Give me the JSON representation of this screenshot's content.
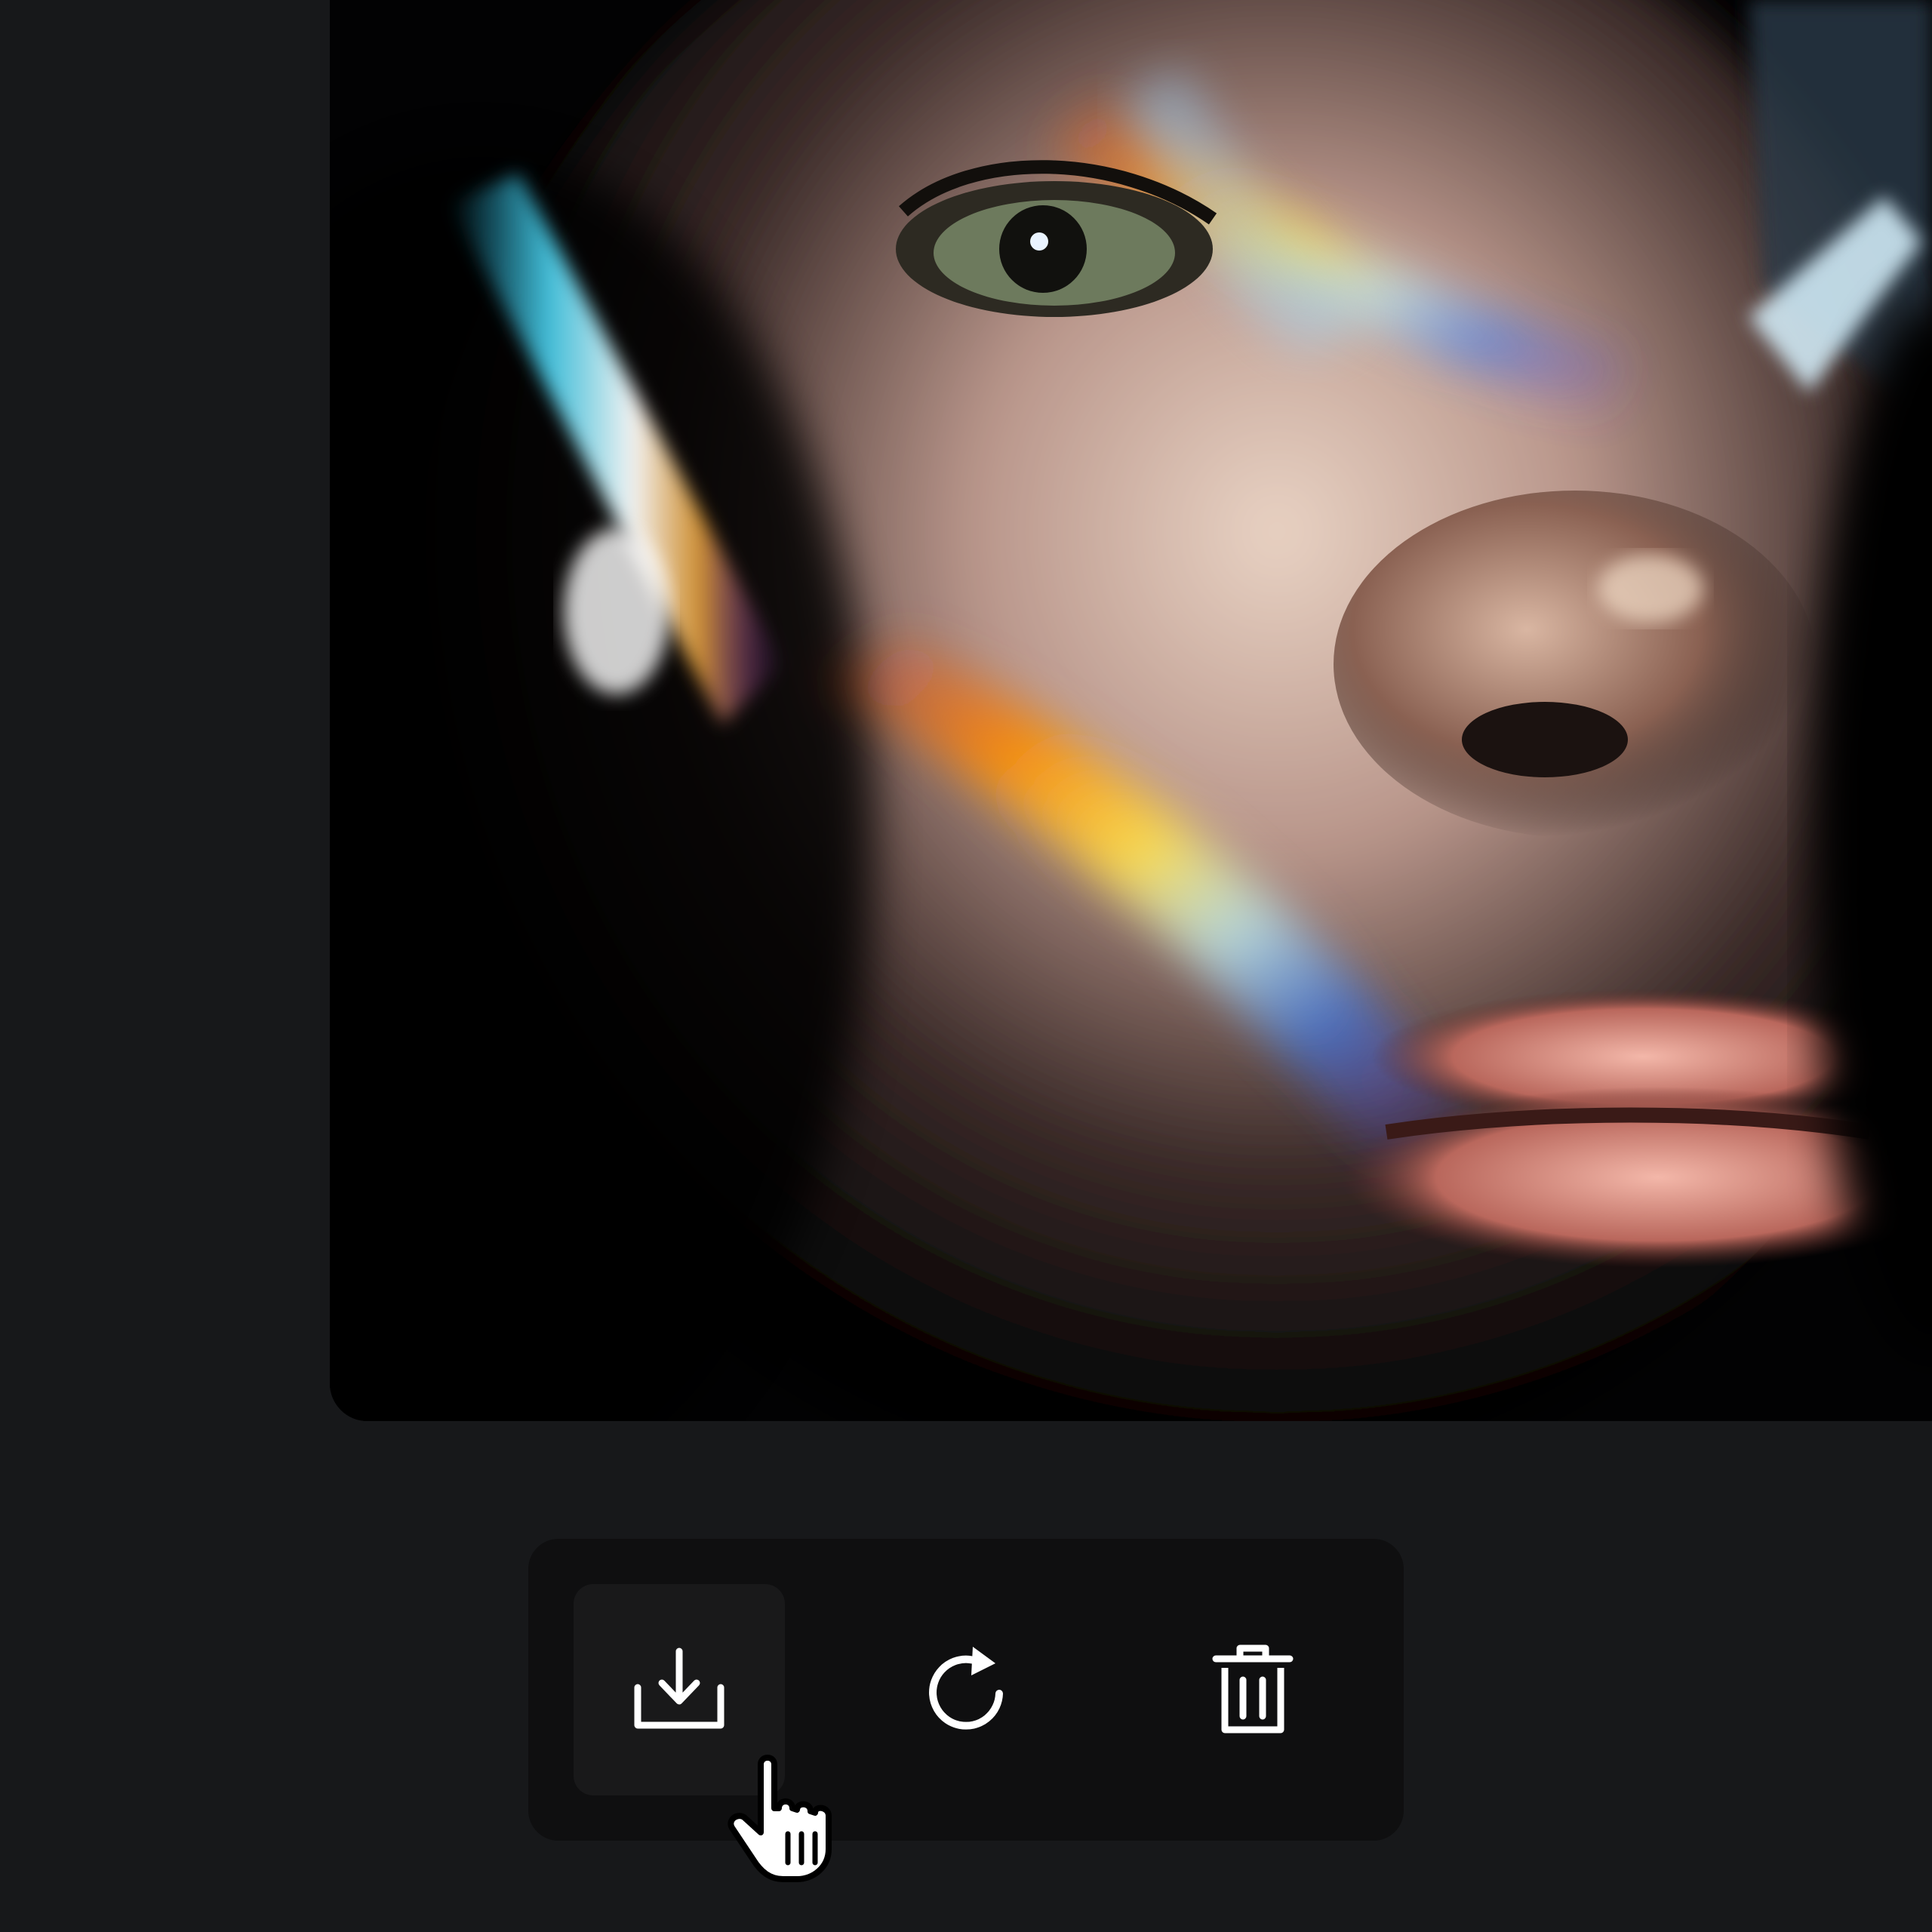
{
  "preview": {
    "image_alt": "",
    "image_icon": "generated-image-preview"
  },
  "toolbar": {
    "actions": [
      {
        "id": "download",
        "icon": "download-icon",
        "state": "hover"
      },
      {
        "id": "regenerate",
        "icon": "refresh-icon",
        "state": "default"
      },
      {
        "id": "delete",
        "icon": "trash-icon",
        "state": "default"
      }
    ]
  },
  "cursor": {
    "icon": "pointer-hand-icon"
  },
  "colors": {
    "page_background": "#17181a",
    "toolbar_background": "#0f0f10",
    "hover_background": "#19191a",
    "icon_color": "#ffffff"
  }
}
